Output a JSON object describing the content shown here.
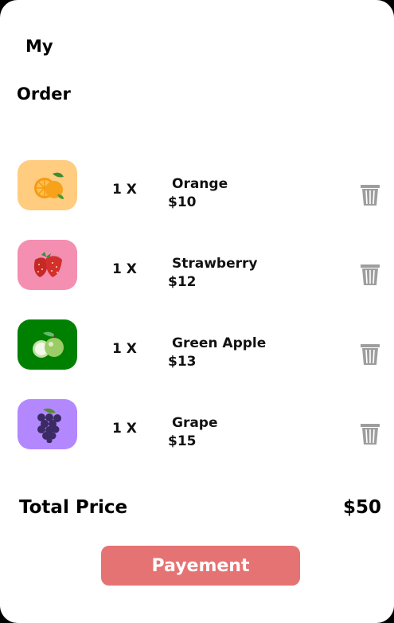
{
  "header": {
    "title_line1": "My",
    "title_line2": "Order"
  },
  "items": [
    {
      "quantity": "1 X",
      "name": "Orange",
      "price": "$10",
      "bg": "#ffcc80",
      "icon": "orange-icon"
    },
    {
      "quantity": "1 X",
      "name": "Strawberry",
      "price": "$12",
      "bg": "#f48fb1",
      "icon": "strawberry-icon"
    },
    {
      "quantity": "1 X",
      "name": "Green Apple",
      "price": "$13",
      "bg": "#008000",
      "icon": "green-apple-icon"
    },
    {
      "quantity": "1 X",
      "name": "Grape",
      "price": "$15",
      "bg": "#b388ff",
      "icon": "grape-icon"
    }
  ],
  "total": {
    "label": "Total Price",
    "value": "$50"
  },
  "payment": {
    "label": "Payement",
    "color": "#e57373"
  }
}
